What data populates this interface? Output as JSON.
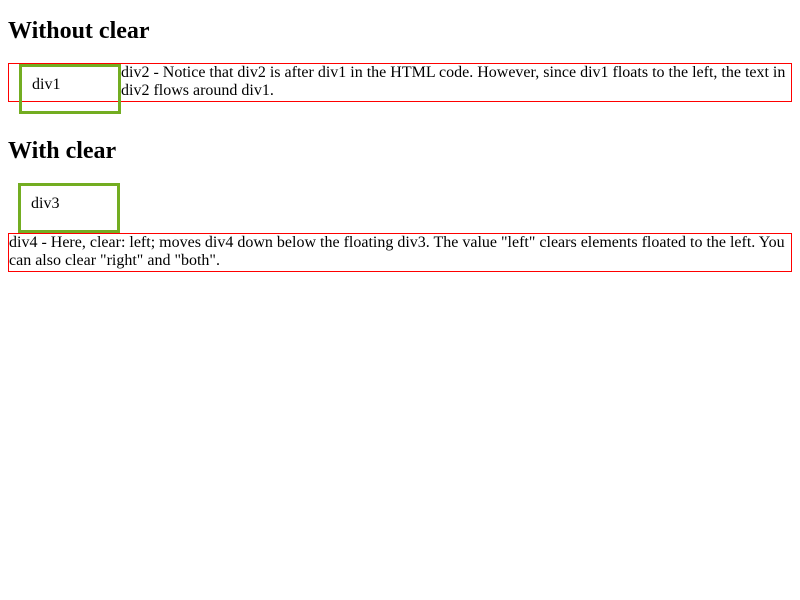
{
  "section1": {
    "heading": "Without clear",
    "div1": "div1",
    "div2": "div2 - Notice that div2 is after div1 in the HTML code. However, since div1 floats to the left, the text in div2 flows around div1."
  },
  "section2": {
    "heading": "With clear",
    "div3": "div3",
    "div4": "div4 - Here, clear: left; moves div4 down below the floating div3. The value \"left\" clears elements floated to the left. You can also clear \"right\" and \"both\"."
  }
}
